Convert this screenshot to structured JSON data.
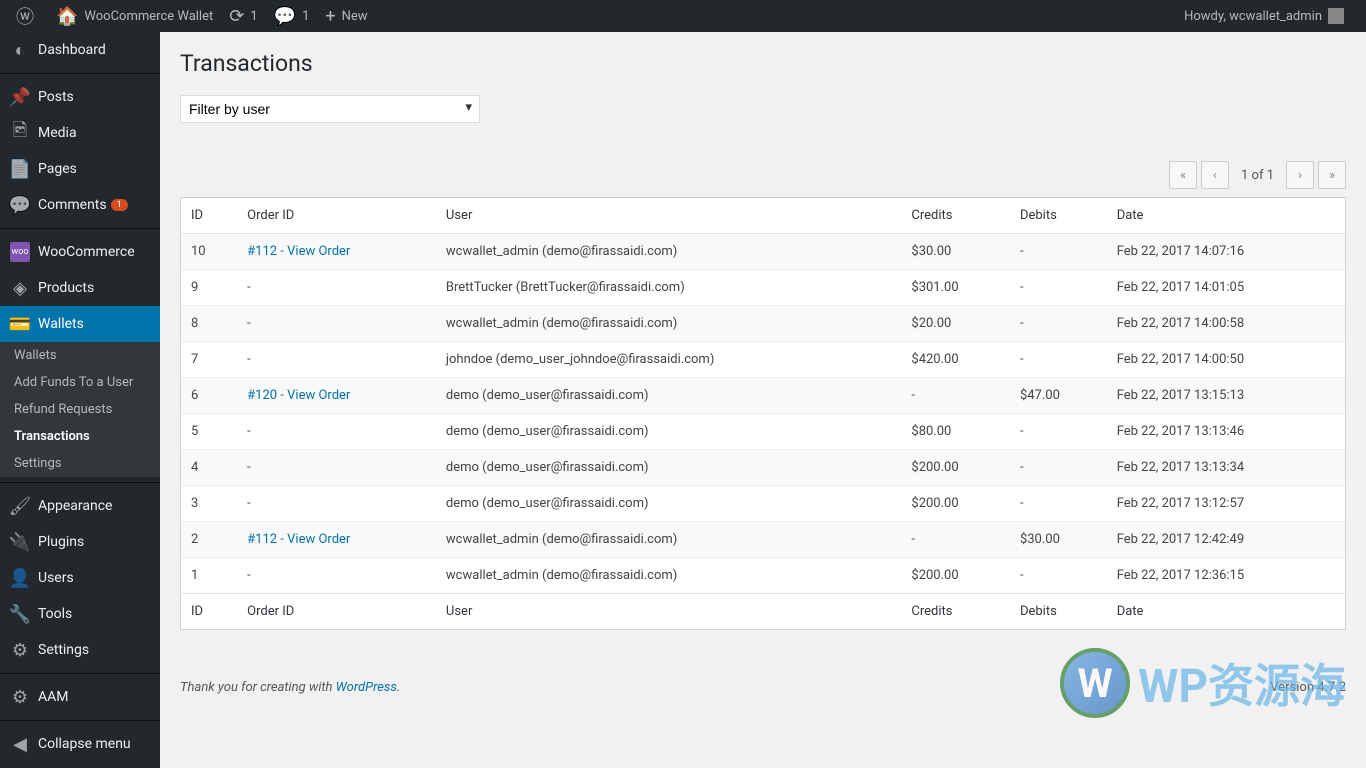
{
  "adminbar": {
    "site_name": "WooCommerce Wallet",
    "updates_count": "1",
    "comments_count": "1",
    "new_label": "New",
    "howdy": "Howdy, wcwallet_admin"
  },
  "sidebar": {
    "items": [
      {
        "label": "Dashboard",
        "icon": "◷"
      },
      {
        "label": "Posts",
        "icon": "📌"
      },
      {
        "label": "Media",
        "icon": "🖻"
      },
      {
        "label": "Pages",
        "icon": "📄"
      },
      {
        "label": "Comments",
        "icon": "💬",
        "badge": "1"
      },
      {
        "label": "WooCommerce",
        "icon": "woo"
      },
      {
        "label": "Products",
        "icon": "◆"
      },
      {
        "label": "Wallets",
        "icon": "💳",
        "active": true
      },
      {
        "label": "Appearance",
        "icon": "🖌"
      },
      {
        "label": "Plugins",
        "icon": "🔌"
      },
      {
        "label": "Users",
        "icon": "👤"
      },
      {
        "label": "Tools",
        "icon": "🔧"
      },
      {
        "label": "Settings",
        "icon": "⚙"
      },
      {
        "label": "AAM",
        "icon": "⚙"
      }
    ],
    "submenu": [
      {
        "label": "Wallets"
      },
      {
        "label": "Add Funds To a User"
      },
      {
        "label": "Refund Requests"
      },
      {
        "label": "Transactions",
        "current": true
      },
      {
        "label": "Settings"
      }
    ],
    "collapse": "Collapse menu"
  },
  "page": {
    "title": "Transactions",
    "filter_placeholder": "Filter by user",
    "page_info": "1 of 1"
  },
  "table": {
    "headers": [
      "ID",
      "Order ID",
      "User",
      "Credits",
      "Debits",
      "Date"
    ],
    "rows": [
      {
        "id": "10",
        "order": "#112 - View Order",
        "user": "wcwallet_admin (demo@firassaidi.com)",
        "credits": "$30.00",
        "debits": "-",
        "date": "Feb 22, 2017 14:07:16"
      },
      {
        "id": "9",
        "order": "-",
        "user": "BrettTucker (BrettTucker@firassaidi.com)",
        "credits": "$301.00",
        "debits": "-",
        "date": "Feb 22, 2017 14:01:05"
      },
      {
        "id": "8",
        "order": "-",
        "user": "wcwallet_admin (demo@firassaidi.com)",
        "credits": "$20.00",
        "debits": "-",
        "date": "Feb 22, 2017 14:00:58"
      },
      {
        "id": "7",
        "order": "-",
        "user": "johndoe (demo_user_johndoe@firassaidi.com)",
        "credits": "$420.00",
        "debits": "-",
        "date": "Feb 22, 2017 14:00:50"
      },
      {
        "id": "6",
        "order": "#120 - View Order",
        "user": "demo (demo_user@firassaidi.com)",
        "credits": "-",
        "debits": "$47.00",
        "date": "Feb 22, 2017 13:15:13"
      },
      {
        "id": "5",
        "order": "-",
        "user": "demo (demo_user@firassaidi.com)",
        "credits": "$80.00",
        "debits": "-",
        "date": "Feb 22, 2017 13:13:46"
      },
      {
        "id": "4",
        "order": "-",
        "user": "demo (demo_user@firassaidi.com)",
        "credits": "$200.00",
        "debits": "-",
        "date": "Feb 22, 2017 13:13:34"
      },
      {
        "id": "3",
        "order": "-",
        "user": "demo (demo_user@firassaidi.com)",
        "credits": "$200.00",
        "debits": "-",
        "date": "Feb 22, 2017 13:12:57"
      },
      {
        "id": "2",
        "order": "#112 - View Order",
        "user": "wcwallet_admin (demo@firassaidi.com)",
        "credits": "-",
        "debits": "$30.00",
        "date": "Feb 22, 2017 12:42:49"
      },
      {
        "id": "1",
        "order": "-",
        "user": "wcwallet_admin (demo@firassaidi.com)",
        "credits": "$200.00",
        "debits": "-",
        "date": "Feb 22, 2017 12:36:15"
      }
    ]
  },
  "footer": {
    "thankyou": "Thank you for creating with ",
    "wp": "WordPress",
    "version": "Version 4.7.2"
  },
  "watermark": "WP资源海"
}
